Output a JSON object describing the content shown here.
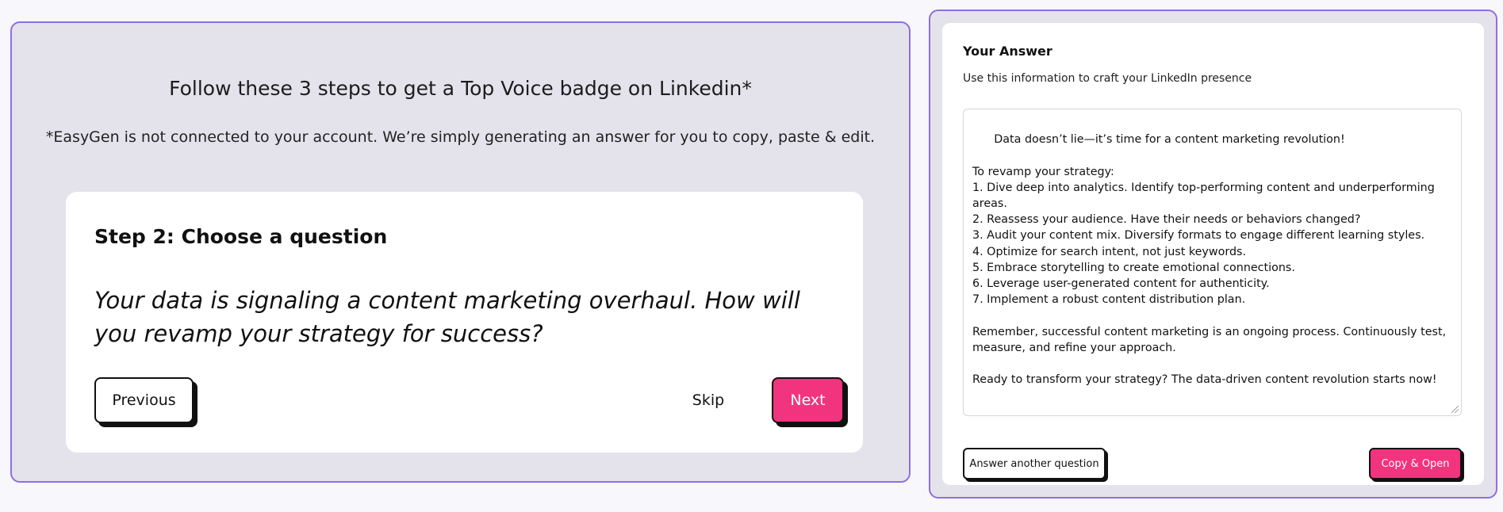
{
  "left": {
    "title": "Follow these 3 steps to get a Top Voice badge on Linkedin*",
    "disclaimer": "*EasyGen is not connected to your account. We’re simply generating an answer for you to copy, paste & edit.",
    "step": {
      "heading": "Step 2: Choose a question",
      "question": "Your data is signaling a content marketing overhaul. How will you revamp your strategy for success?",
      "previous_label": "Previous",
      "skip_label": "Skip",
      "next_label": "Next"
    }
  },
  "right": {
    "heading": "Your Answer",
    "subheading": "Use this information to craft your LinkedIn presence",
    "answer_text": "Data doesn’t lie—it’s time for a content marketing revolution!\n\nTo revamp your strategy:\n1. Dive deep into analytics. Identify top-performing content and underperforming areas.\n2. Reassess your audience. Have their needs or behaviors changed?\n3. Audit your content mix. Diversify formats to engage different learning styles.\n4. Optimize for search intent, not just keywords.\n5. Embrace storytelling to create emotional connections.\n6. Leverage user-generated content for authenticity.\n7. Implement a robust content distribution plan.\n\nRemember, successful content marketing is an ongoing process. Continuously test, measure, and refine your approach.\n\nReady to transform your strategy? The data-driven content revolution starts now!",
    "answer_another_label": "Answer another question",
    "copy_open_label": "Copy & Open"
  },
  "colors": {
    "accent_pink": "#f2337e",
    "panel_border": "#8d6fe0",
    "panel_bg": "#e4e3ec"
  }
}
